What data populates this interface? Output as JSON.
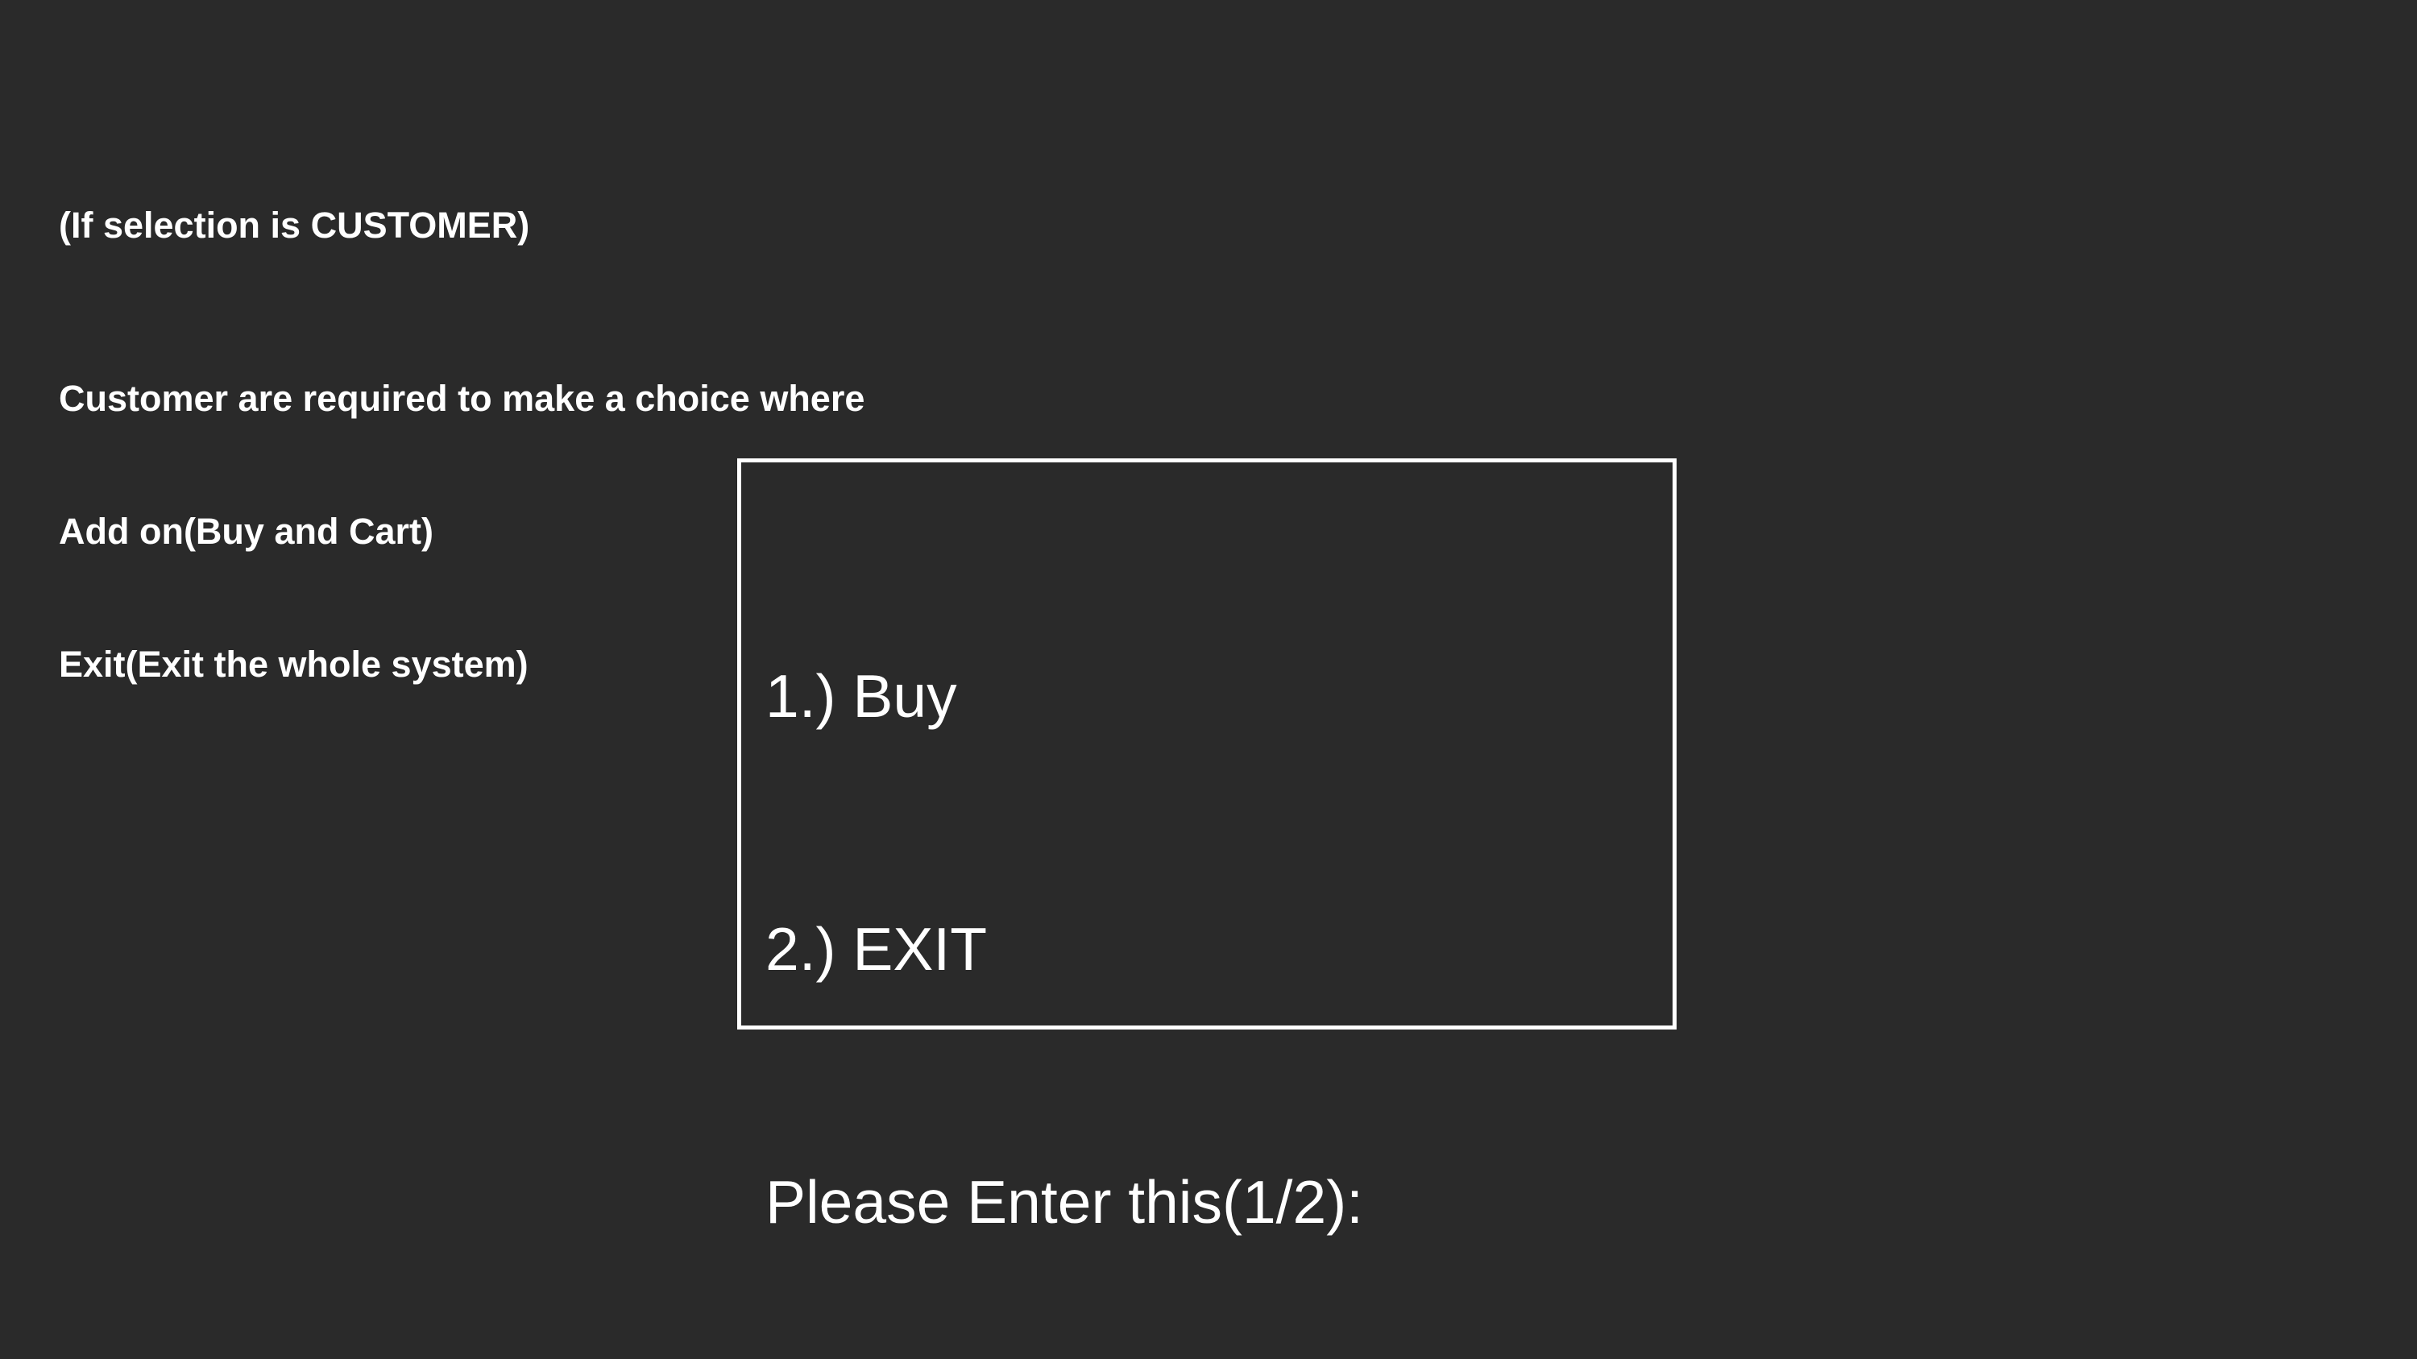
{
  "notes": {
    "heading": "(If selection is CUSTOMER)",
    "lines": [
      "Customer are required to make a choice where",
      "Add on(Buy and Cart)",
      "Exit(Exit the whole system)"
    ]
  },
  "menu": {
    "items": [
      "1.) Buy",
      "2.) EXIT"
    ],
    "prompt": "Please Enter this(1/2):"
  }
}
